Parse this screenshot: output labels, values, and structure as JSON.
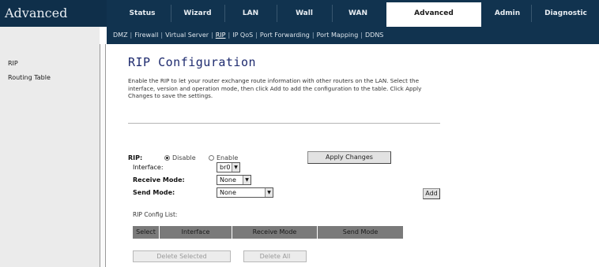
{
  "app": {
    "brand": "Advanced"
  },
  "nav": {
    "tabs": [
      "Status",
      "Wizard",
      "LAN",
      "Wall",
      "WAN",
      "Advanced",
      "Admin",
      "Diagnostic"
    ]
  },
  "subnav": {
    "links": [
      "DMZ",
      "Firewall",
      "Virtual Server",
      "RIP",
      "IP QoS",
      "Port Forwarding",
      "Port Mapping",
      "DDNS"
    ],
    "selected": "RIP"
  },
  "sidebar": {
    "items": [
      "RIP",
      "Routing Table"
    ]
  },
  "page": {
    "title": "RIP Configuration",
    "description": "Enable the RIP to let your router exchange route information with other routers on the LAN. Select the interface, version and operation mode, then click Add to add the configuration to the table. Click Apply Changes to save the settings."
  },
  "rip": {
    "label": "RIP:",
    "options": [
      "Disable",
      "Enable"
    ],
    "selected": "Disable",
    "apply_label": "Apply Changes"
  },
  "form": {
    "interface_label": "Interface:",
    "interface_value": "br0",
    "recv_mode_label": "Receive Mode:",
    "recv_mode_value": "None",
    "send_mode_label": "Send Mode:",
    "send_mode_value": "None",
    "add_label": "Add"
  },
  "table": {
    "title": "RIP Config List:",
    "columns": [
      "Select",
      "Interface",
      "Receive Mode",
      "Send Mode"
    ]
  },
  "actions": {
    "delete_selected": "Delete Selected",
    "delete_all": "Delete All"
  }
}
